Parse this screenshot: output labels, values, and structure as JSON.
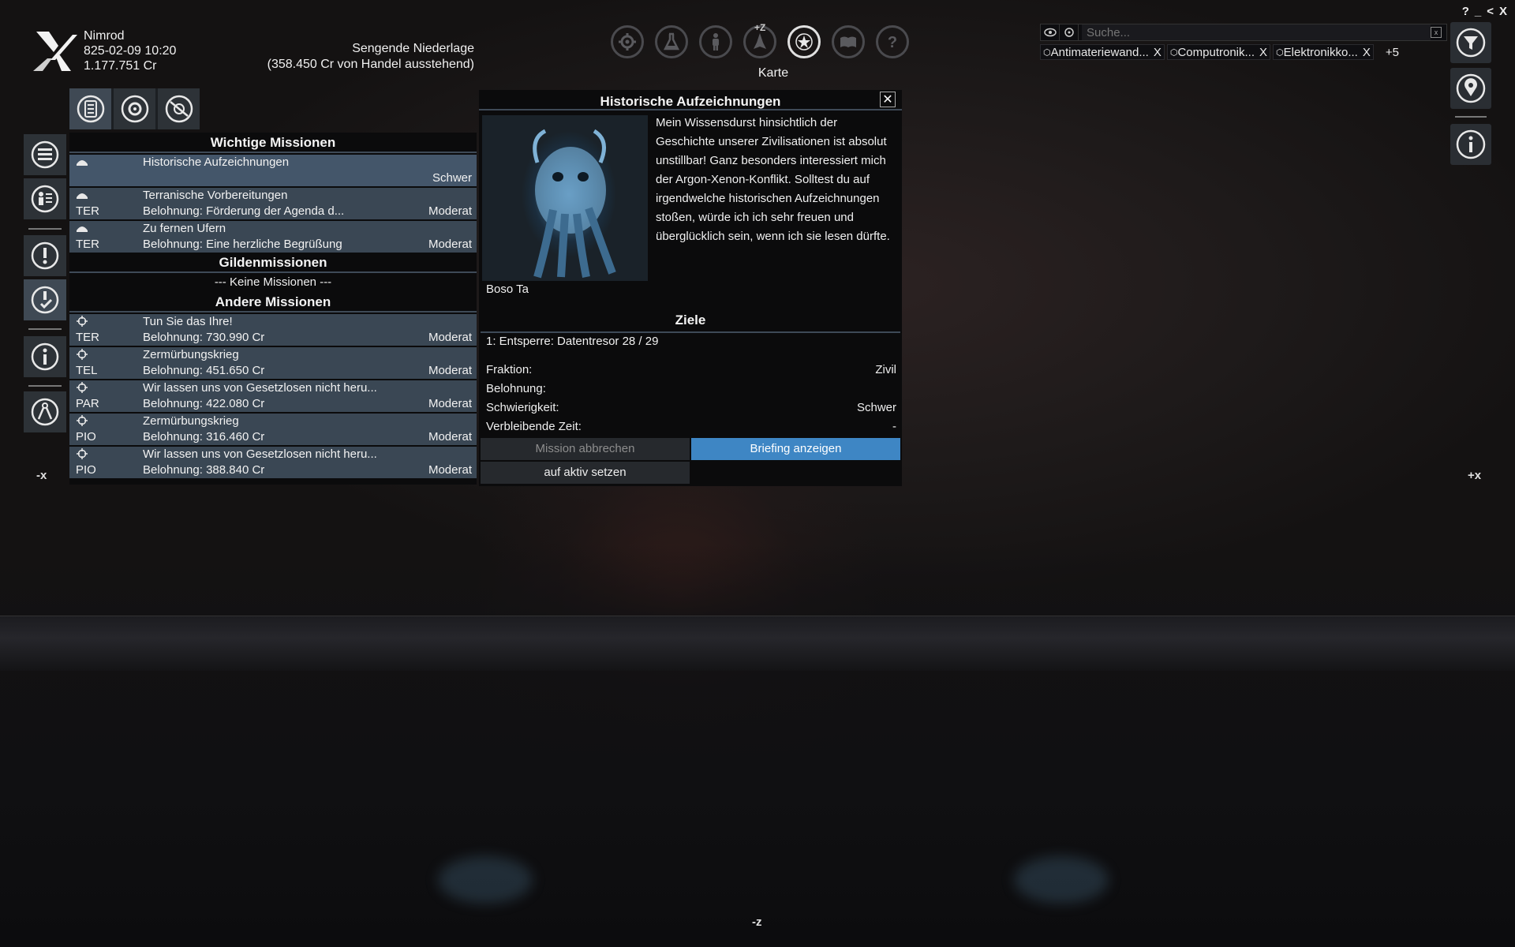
{
  "player": {
    "name": "Nimrod",
    "datetime": "825-02-09 10:20",
    "credits": "1.177.751 Cr"
  },
  "active_mission": {
    "name": "Sengende Niederlage",
    "detail": "(358.450 Cr von Handel ausstehend)"
  },
  "topnav": {
    "z_label": "+Z",
    "current_label": "Karte",
    "items": [
      "gear-icon",
      "flask-icon",
      "person-icon",
      "ship-icon",
      "map-star-icon",
      "encyclopedia-icon",
      "help-icon"
    ]
  },
  "search": {
    "placeholder": "Suche...",
    "chips": [
      {
        "label": "Antimateriewand...",
        "close": "X"
      },
      {
        "label": "Computronik...",
        "close": "X"
      },
      {
        "label": "Elektronikko...",
        "close": "X"
      }
    ],
    "more": "+5"
  },
  "window_controls": [
    "?",
    "_",
    "<",
    "X"
  ],
  "missions": {
    "important_header": "Wichtige Missionen",
    "important": [
      {
        "title": "Historische Aufzeichnungen",
        "faction": "",
        "reward": "",
        "difficulty": "Schwer"
      },
      {
        "title": "Terranische Vorbereitungen",
        "faction": "TER",
        "reward": "Belohnung: Förderung der Agenda d...",
        "difficulty": "Moderat"
      },
      {
        "title": "Zu fernen Ufern",
        "faction": "TER",
        "reward": "Belohnung: Eine herzliche Begrüßung",
        "difficulty": "Moderat"
      }
    ],
    "guild_header": "Gildenmissionen",
    "guild_empty": "--- Keine Missionen ---",
    "other_header": "Andere Missionen",
    "other": [
      {
        "title": "Tun Sie das Ihre!",
        "faction": "TER",
        "reward": "Belohnung: 730.990 Cr",
        "difficulty": "Moderat"
      },
      {
        "title": "Zermürbungskrieg",
        "faction": "TEL",
        "reward": "Belohnung: 451.650 Cr",
        "difficulty": "Moderat"
      },
      {
        "title": "Wir lassen uns von Gesetzlosen nicht heru...",
        "faction": "PAR",
        "reward": "Belohnung: 422.080 Cr",
        "difficulty": "Moderat"
      },
      {
        "title": "Zermürbungskrieg",
        "faction": "PIO",
        "reward": "Belohnung: 316.460 Cr",
        "difficulty": "Moderat"
      },
      {
        "title": "Wir lassen uns von Gesetzlosen nicht heru...",
        "faction": "PIO",
        "reward": "Belohnung: 388.840 Cr",
        "difficulty": "Moderat"
      }
    ]
  },
  "detail": {
    "title": "Historische Aufzeichnungen",
    "description": "Mein Wissensdurst hinsichtlich der Geschichte unserer Zivilisationen ist absolut unstillbar! Ganz besonders interessiert mich der Argon-Xenon-Konflikt. Solltest du auf irgendwelche historischen Aufzeichnungen stoßen, würde ich ich sehr freuen und überglücklich sein, wenn ich sie lesen dürfte.",
    "giver": "Boso Ta",
    "goals_header": "Ziele",
    "goal": "1: Entsperre: Datentresor 28 / 29",
    "faction_label": "Fraktion:",
    "faction_value": "Zivil",
    "reward_label": "Belohnung:",
    "reward_value": "",
    "difficulty_label": "Schwierigkeit:",
    "difficulty_value": "Schwer",
    "time_label": "Verbleibende Zeit:",
    "time_value": "-",
    "abort_button": "Mission abbrechen",
    "briefing_button": "Briefing anzeigen",
    "activate_button": "auf aktiv setzen"
  },
  "axes": {
    "neg_x": "-x",
    "pos_x": "+x",
    "neg_z": "-z"
  }
}
